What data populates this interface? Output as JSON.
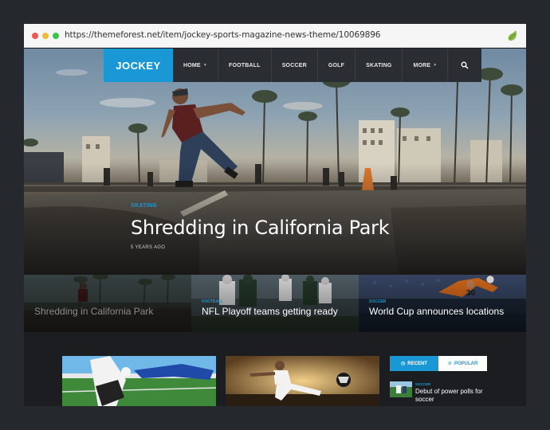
{
  "browser": {
    "url": "https://themeforest.net/item/jockey-sports-magazine-news-theme/10069896"
  },
  "site": {
    "logo": "JOCKEY",
    "nav": [
      {
        "label": "HOME",
        "has_dropdown": true
      },
      {
        "label": "FOOTBALL",
        "has_dropdown": false
      },
      {
        "label": "SOCCER",
        "has_dropdown": false
      },
      {
        "label": "GOLF",
        "has_dropdown": false
      },
      {
        "label": "SKATING",
        "has_dropdown": false
      },
      {
        "label": "MORE",
        "has_dropdown": true
      }
    ],
    "accent": "#1a98d5"
  },
  "hero": {
    "category": "SKATING",
    "title": "Shredding in California Park",
    "time": "5 YEARS AGO"
  },
  "cards": [
    {
      "category": "",
      "title": "Shredding in California Park"
    },
    {
      "category": "FOOTBALL",
      "title": "NFL Playoff teams getting ready"
    },
    {
      "category": "SOCCER",
      "title": "World Cup announces locations"
    }
  ],
  "sidebar": {
    "tabs": [
      {
        "label": "RECENT",
        "active": true
      },
      {
        "label": "POPULAR",
        "active": false
      }
    ],
    "item": {
      "category": "SOCCER",
      "title": "Debut of power polls for soccer"
    }
  }
}
